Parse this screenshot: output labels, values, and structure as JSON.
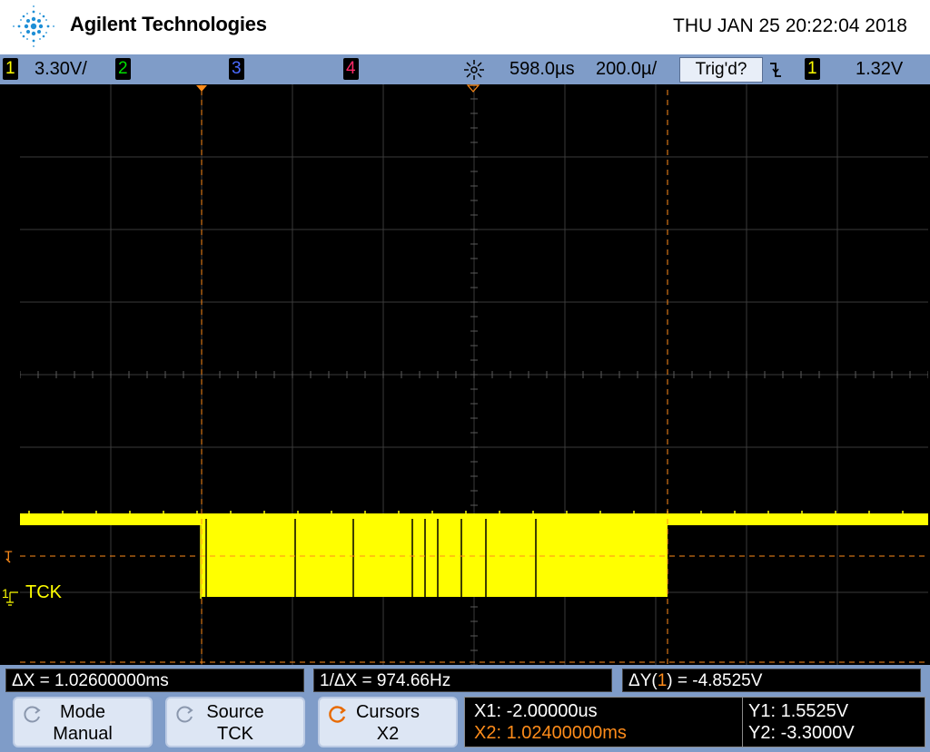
{
  "header": {
    "brand": "Agilent Technologies",
    "datetime": "THU JAN 25 20:22:04 2018",
    "logo_icon": "agilent-spark-logo"
  },
  "status": {
    "ch1_num": "1",
    "ch1_scale": "3.30V/",
    "ch2_num": "2",
    "ch3_num": "3",
    "ch4_num": "4",
    "acq_icon": "acquisition-icon",
    "delay": "598.0µs",
    "timebase": "200.0µ/",
    "trig_status": "Trig'd?",
    "trig_slope_icon": "falling-edge-icon",
    "trig_src": "1",
    "trig_level": "1.32V",
    "colors": {
      "ch1": "#ffff00",
      "ch2": "#00e000",
      "ch3": "#4a6bff",
      "ch4": "#ff2a6a"
    }
  },
  "scope": {
    "channel_label": "TCK",
    "ground_marker": "1",
    "trigger_marker": "T",
    "trace_color": "#ffff00",
    "cursor_color": "#ff8c1a"
  },
  "measurements": {
    "dx": "ΔX = 1.02600000ms",
    "inv_dx": "1/ΔX = 974.66Hz",
    "dy_prefix": "ΔY(",
    "dy_channel": "1",
    "dy_suffix": ") = -4.8525V"
  },
  "softkeys": {
    "mode_title": "Mode",
    "mode_value": "Manual",
    "source_title": "Source",
    "source_value": "TCK",
    "cursors_title": "Cursors",
    "cursors_value": "X2"
  },
  "cursor_readout": {
    "x1": "X1: -2.00000us",
    "x2": "X2: 1.02400000ms",
    "y1": "Y1: 1.5525V",
    "y2": "Y2: -3.3000V"
  }
}
